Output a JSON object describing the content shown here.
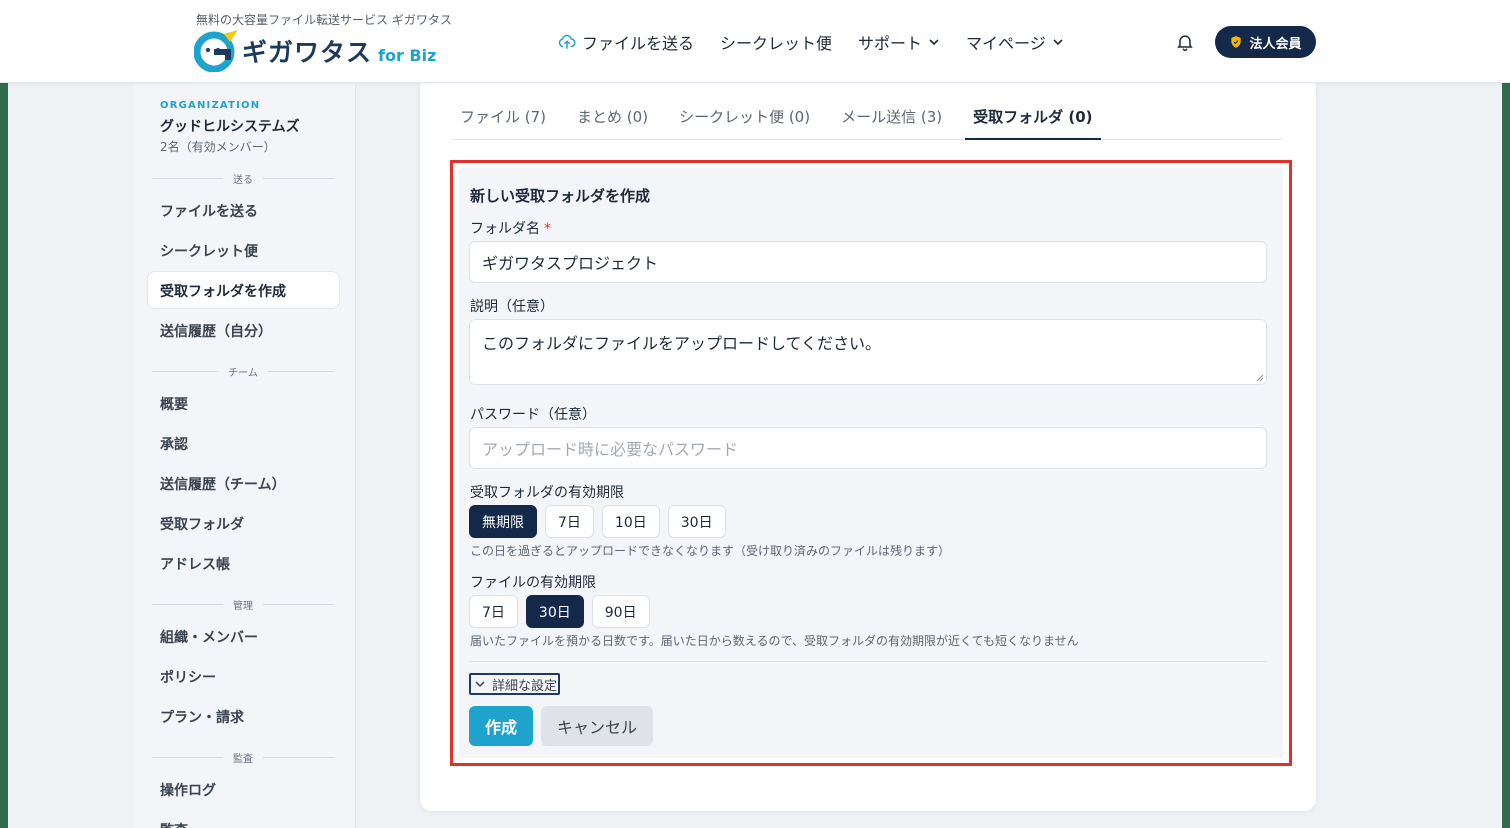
{
  "header": {
    "tagline": "無料の大容量ファイル転送サービス ギガワタス",
    "logo_text": "ギガワタス",
    "logo_suffix": "for Biz",
    "nav": [
      {
        "label": "ファイルを送る",
        "icon": "cloud-upload-icon"
      },
      {
        "label": "シークレット便"
      },
      {
        "label": "サポート",
        "icon": "chevron-down-icon"
      },
      {
        "label": "マイページ",
        "icon": "chevron-down-icon"
      }
    ],
    "member_badge": "法人会員"
  },
  "sidebar": {
    "org_label": "ORGANIZATION",
    "org_name": "グッドヒルシステムズ",
    "org_members": "2名（有効メンバー）",
    "sections": {
      "send": "送る",
      "team": "チーム",
      "manage": "管理",
      "audit": "監査"
    },
    "items": {
      "send_file": "ファイルを送る",
      "secret": "シークレット便",
      "create_folder": "受取フォルダを作成",
      "history_self": "送信履歴（自分）",
      "overview": "概要",
      "approval": "承認",
      "history_team": "送信履歴（チーム）",
      "receive_folder": "受取フォルダ",
      "address_book": "アドレス帳",
      "org_members": "組織・メンバー",
      "policy": "ポリシー",
      "plan": "プラン・請求",
      "op_log": "操作ログ",
      "audit": "監査"
    }
  },
  "tabs": [
    {
      "label": "ファイル (7)"
    },
    {
      "label": "まとめ (0)"
    },
    {
      "label": "シークレット便 (0)"
    },
    {
      "label": "メール送信 (3)"
    },
    {
      "label": "受取フォルダ (0)",
      "active": true
    }
  ],
  "form": {
    "title": "新しい受取フォルダを作成",
    "folder_name_label": "フォルダ名",
    "required_mark": "*",
    "folder_name_value": "ギガワタスプロジェクト",
    "description_label": "説明（任意）",
    "description_value": "このフォルダにファイルをアップロードしてください。",
    "password_label": "パスワード（任意）",
    "password_placeholder": "アップロード時に必要なパスワード",
    "folder_expiry_label": "受取フォルダの有効期限",
    "folder_expiry_options": [
      "無期限",
      "7日",
      "10日",
      "30日"
    ],
    "folder_expiry_selected": "無期限",
    "folder_expiry_hint": "この日を過ぎるとアップロードできなくなります（受け取り済みのファイルは残ります）",
    "file_expiry_label": "ファイルの有効期限",
    "file_expiry_options": [
      "7日",
      "30日",
      "90日"
    ],
    "file_expiry_selected": "30日",
    "file_expiry_hint": "届いたファイルを預かる日数です。届いた日から数えるので、受取フォルダの有効期限が近くても短くなりません",
    "advanced_label": "詳細な設定",
    "create_button": "作成",
    "cancel_button": "キャンセル"
  },
  "colors": {
    "navy": "#14284a",
    "accent": "#1ea3cd",
    "highlight": "#e0322a"
  }
}
